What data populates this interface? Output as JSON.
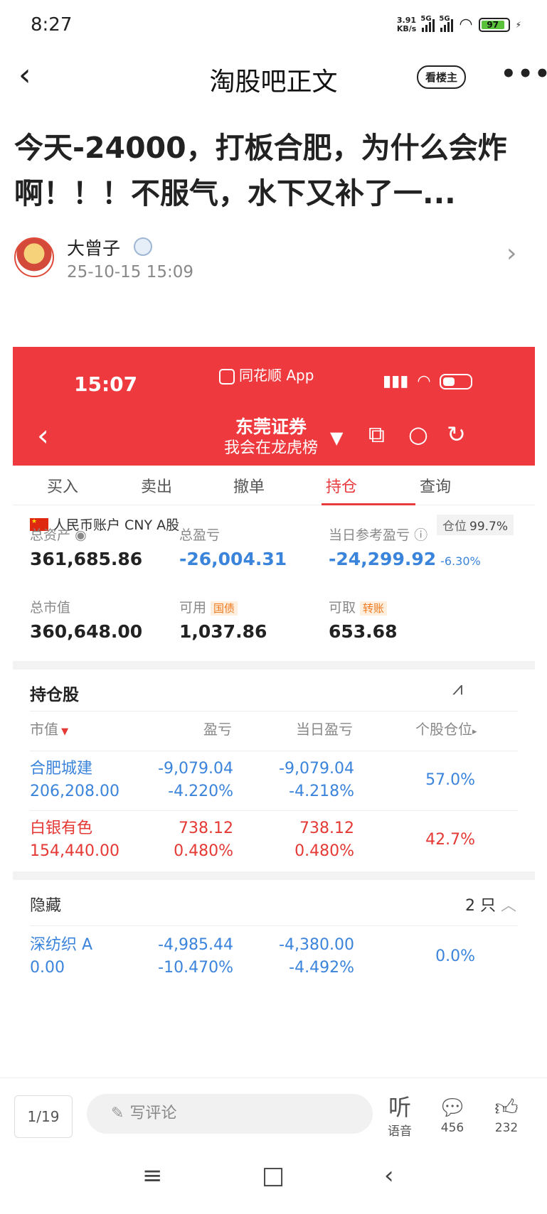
{
  "status_bar": {
    "time": "8:27",
    "net_speed_value": "3.91",
    "net_speed_unit": "KB/s",
    "net1": "5G",
    "net2": "5G",
    "battery": "97"
  },
  "header": {
    "back_icon": "‹",
    "title": "淘股吧正文",
    "only_op_label": "看楼主",
    "more_icon": "•••"
  },
  "post": {
    "title": "今天-24000，打板合肥，为什么会炸啊！！！不服气，水下又补了一...",
    "author": "大曾子",
    "date": "25-10-15 15:09"
  },
  "screenshot": {
    "time": "15:07",
    "app_name": "同花顺 App",
    "broker": "东莞证券",
    "broker_sub": "我会在龙虎榜",
    "tabs": [
      "买入",
      "卖出",
      "撤单",
      "持仓",
      "查询"
    ],
    "active_tab": "持仓",
    "account_label": "人民币账户 CNY A股",
    "position_label": "仓位",
    "position_value": "99.7%",
    "summary": {
      "total_assets_label": "总资产",
      "total_assets": "361,685.86",
      "total_pnl_label": "总盈亏",
      "total_pnl": "-26,004.31",
      "today_pnl_label": "当日参考盈亏",
      "today_pnl": "-24,299.92",
      "today_pnl_pct": "-6.30%",
      "market_value_label": "总市值",
      "market_value": "360,648.00",
      "available_label": "可用",
      "available_tag": "国债",
      "available": "1,037.86",
      "withdrawable_label": "可取",
      "withdrawable_tag": "转账",
      "withdrawable": "653.68"
    },
    "holdings_title": "持仓股",
    "columns": [
      "市值",
      "盈亏",
      "当日盈亏",
      "个股仓位"
    ],
    "holdings": [
      {
        "name": "合肥城建",
        "market_value": "206,208.00",
        "pnl": "-9,079.04",
        "pnl_pct": "-4.220%",
        "today_pnl": "-9,079.04",
        "today_pct": "-4.218%",
        "weight": "57.0%",
        "color": "#3b84db"
      },
      {
        "name": "白银有色",
        "market_value": "154,440.00",
        "pnl": "738.12",
        "pnl_pct": "0.480%",
        "today_pnl": "738.12",
        "today_pct": "0.480%",
        "weight": "42.7%",
        "color": "#e53935"
      }
    ],
    "hidden_label": "隐藏",
    "hidden_count": "2 只",
    "hidden_holdings": [
      {
        "name": "深纺织 A",
        "market_value": "0.00",
        "pnl": "-4,985.44",
        "pnl_pct": "-10.470%",
        "today_pnl": "-4,380.00",
        "today_pct": "-4.492%",
        "weight": "0.0%",
        "color": "#3b84db"
      }
    ]
  },
  "bottom_bar": {
    "page_indicator": "1/19",
    "comment_placeholder": "写评论",
    "listen_label": "语音",
    "listen_icon": "听",
    "comments_count": "456",
    "likes_count": "232"
  },
  "nav_bar": {
    "menu_icon": "≡",
    "home_icon": "□",
    "back_icon": "‹"
  }
}
